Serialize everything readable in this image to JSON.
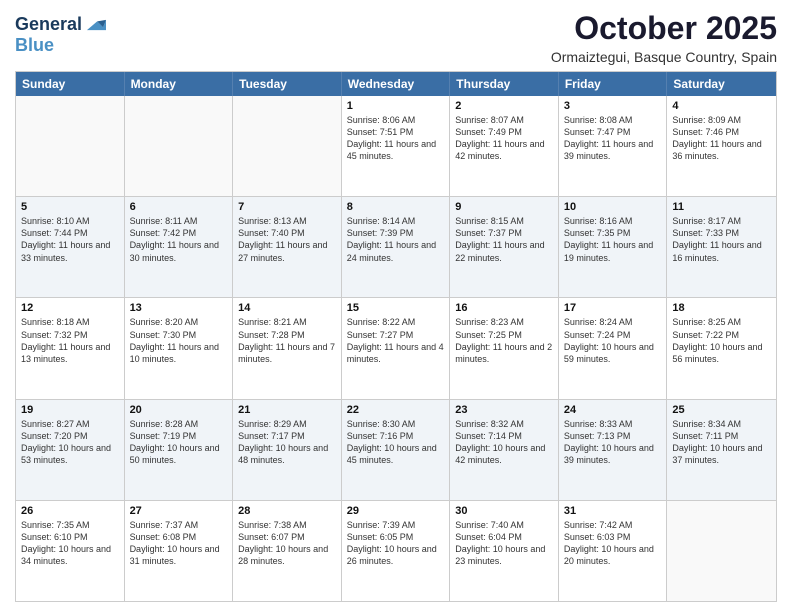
{
  "header": {
    "logo_line1": "General",
    "logo_line2": "Blue",
    "month": "October 2025",
    "location": "Ormaiztegui, Basque Country, Spain"
  },
  "weekdays": [
    "Sunday",
    "Monday",
    "Tuesday",
    "Wednesday",
    "Thursday",
    "Friday",
    "Saturday"
  ],
  "rows": [
    [
      {
        "day": "",
        "info": ""
      },
      {
        "day": "",
        "info": ""
      },
      {
        "day": "",
        "info": ""
      },
      {
        "day": "1",
        "info": "Sunrise: 8:06 AM\nSunset: 7:51 PM\nDaylight: 11 hours and 45 minutes."
      },
      {
        "day": "2",
        "info": "Sunrise: 8:07 AM\nSunset: 7:49 PM\nDaylight: 11 hours and 42 minutes."
      },
      {
        "day": "3",
        "info": "Sunrise: 8:08 AM\nSunset: 7:47 PM\nDaylight: 11 hours and 39 minutes."
      },
      {
        "day": "4",
        "info": "Sunrise: 8:09 AM\nSunset: 7:46 PM\nDaylight: 11 hours and 36 minutes."
      }
    ],
    [
      {
        "day": "5",
        "info": "Sunrise: 8:10 AM\nSunset: 7:44 PM\nDaylight: 11 hours and 33 minutes."
      },
      {
        "day": "6",
        "info": "Sunrise: 8:11 AM\nSunset: 7:42 PM\nDaylight: 11 hours and 30 minutes."
      },
      {
        "day": "7",
        "info": "Sunrise: 8:13 AM\nSunset: 7:40 PM\nDaylight: 11 hours and 27 minutes."
      },
      {
        "day": "8",
        "info": "Sunrise: 8:14 AM\nSunset: 7:39 PM\nDaylight: 11 hours and 24 minutes."
      },
      {
        "day": "9",
        "info": "Sunrise: 8:15 AM\nSunset: 7:37 PM\nDaylight: 11 hours and 22 minutes."
      },
      {
        "day": "10",
        "info": "Sunrise: 8:16 AM\nSunset: 7:35 PM\nDaylight: 11 hours and 19 minutes."
      },
      {
        "day": "11",
        "info": "Sunrise: 8:17 AM\nSunset: 7:33 PM\nDaylight: 11 hours and 16 minutes."
      }
    ],
    [
      {
        "day": "12",
        "info": "Sunrise: 8:18 AM\nSunset: 7:32 PM\nDaylight: 11 hours and 13 minutes."
      },
      {
        "day": "13",
        "info": "Sunrise: 8:20 AM\nSunset: 7:30 PM\nDaylight: 11 hours and 10 minutes."
      },
      {
        "day": "14",
        "info": "Sunrise: 8:21 AM\nSunset: 7:28 PM\nDaylight: 11 hours and 7 minutes."
      },
      {
        "day": "15",
        "info": "Sunrise: 8:22 AM\nSunset: 7:27 PM\nDaylight: 11 hours and 4 minutes."
      },
      {
        "day": "16",
        "info": "Sunrise: 8:23 AM\nSunset: 7:25 PM\nDaylight: 11 hours and 2 minutes."
      },
      {
        "day": "17",
        "info": "Sunrise: 8:24 AM\nSunset: 7:24 PM\nDaylight: 10 hours and 59 minutes."
      },
      {
        "day": "18",
        "info": "Sunrise: 8:25 AM\nSunset: 7:22 PM\nDaylight: 10 hours and 56 minutes."
      }
    ],
    [
      {
        "day": "19",
        "info": "Sunrise: 8:27 AM\nSunset: 7:20 PM\nDaylight: 10 hours and 53 minutes."
      },
      {
        "day": "20",
        "info": "Sunrise: 8:28 AM\nSunset: 7:19 PM\nDaylight: 10 hours and 50 minutes."
      },
      {
        "day": "21",
        "info": "Sunrise: 8:29 AM\nSunset: 7:17 PM\nDaylight: 10 hours and 48 minutes."
      },
      {
        "day": "22",
        "info": "Sunrise: 8:30 AM\nSunset: 7:16 PM\nDaylight: 10 hours and 45 minutes."
      },
      {
        "day": "23",
        "info": "Sunrise: 8:32 AM\nSunset: 7:14 PM\nDaylight: 10 hours and 42 minutes."
      },
      {
        "day": "24",
        "info": "Sunrise: 8:33 AM\nSunset: 7:13 PM\nDaylight: 10 hours and 39 minutes."
      },
      {
        "day": "25",
        "info": "Sunrise: 8:34 AM\nSunset: 7:11 PM\nDaylight: 10 hours and 37 minutes."
      }
    ],
    [
      {
        "day": "26",
        "info": "Sunrise: 7:35 AM\nSunset: 6:10 PM\nDaylight: 10 hours and 34 minutes."
      },
      {
        "day": "27",
        "info": "Sunrise: 7:37 AM\nSunset: 6:08 PM\nDaylight: 10 hours and 31 minutes."
      },
      {
        "day": "28",
        "info": "Sunrise: 7:38 AM\nSunset: 6:07 PM\nDaylight: 10 hours and 28 minutes."
      },
      {
        "day": "29",
        "info": "Sunrise: 7:39 AM\nSunset: 6:05 PM\nDaylight: 10 hours and 26 minutes."
      },
      {
        "day": "30",
        "info": "Sunrise: 7:40 AM\nSunset: 6:04 PM\nDaylight: 10 hours and 23 minutes."
      },
      {
        "day": "31",
        "info": "Sunrise: 7:42 AM\nSunset: 6:03 PM\nDaylight: 10 hours and 20 minutes."
      },
      {
        "day": "",
        "info": ""
      }
    ]
  ]
}
